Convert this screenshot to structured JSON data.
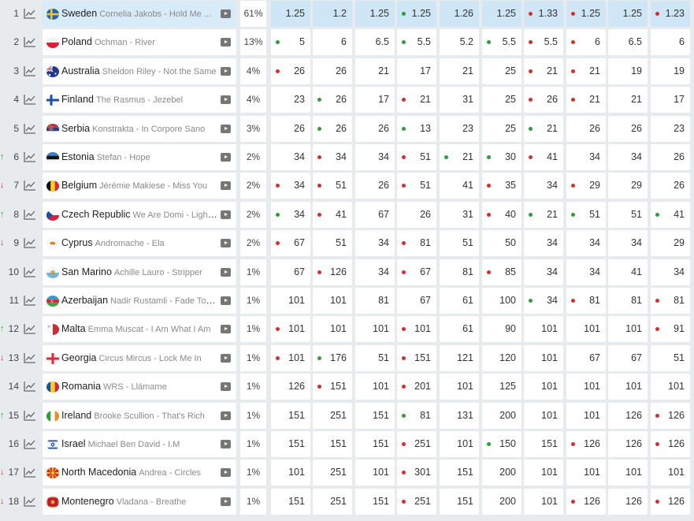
{
  "rows": [
    {
      "rank": "1",
      "trend": "",
      "country": "Sweden",
      "song": "Cornelia Jakobs - Hold Me ...",
      "pct": "61%",
      "flag": "sweden",
      "odds": [
        {
          "v": "1.25",
          "d": ""
        },
        {
          "v": "1.2",
          "d": ""
        },
        {
          "v": "1.25",
          "d": ""
        },
        {
          "v": "1.25",
          "d": "green"
        },
        {
          "v": "1.26",
          "d": ""
        },
        {
          "v": "1.25",
          "d": ""
        },
        {
          "v": "1.33",
          "d": "red"
        },
        {
          "v": "1.25",
          "d": "red"
        },
        {
          "v": "1.25",
          "d": ""
        },
        {
          "v": "1.23",
          "d": "red"
        }
      ]
    },
    {
      "rank": "2",
      "trend": "",
      "country": "Poland",
      "song": "Ochman - River",
      "pct": "13%",
      "flag": "poland",
      "odds": [
        {
          "v": "5",
          "d": "green"
        },
        {
          "v": "6",
          "d": ""
        },
        {
          "v": "6.5",
          "d": ""
        },
        {
          "v": "5.5",
          "d": "green"
        },
        {
          "v": "5.2",
          "d": ""
        },
        {
          "v": "5.5",
          "d": "green"
        },
        {
          "v": "5.5",
          "d": "red"
        },
        {
          "v": "6",
          "d": "red"
        },
        {
          "v": "6.5",
          "d": ""
        },
        {
          "v": "6",
          "d": ""
        }
      ]
    },
    {
      "rank": "3",
      "trend": "",
      "country": "Australia",
      "song": "Sheldon Riley - Not the Same",
      "pct": "4%",
      "flag": "australia",
      "odds": [
        {
          "v": "26",
          "d": "red"
        },
        {
          "v": "26",
          "d": ""
        },
        {
          "v": "21",
          "d": ""
        },
        {
          "v": "17",
          "d": ""
        },
        {
          "v": "21",
          "d": ""
        },
        {
          "v": "25",
          "d": ""
        },
        {
          "v": "21",
          "d": "red"
        },
        {
          "v": "21",
          "d": "red"
        },
        {
          "v": "19",
          "d": ""
        },
        {
          "v": "19",
          "d": ""
        }
      ]
    },
    {
      "rank": "4",
      "trend": "",
      "country": "Finland",
      "song": "The Rasmus - Jezebel",
      "pct": "4%",
      "flag": "finland",
      "odds": [
        {
          "v": "23",
          "d": ""
        },
        {
          "v": "26",
          "d": "green"
        },
        {
          "v": "17",
          "d": ""
        },
        {
          "v": "21",
          "d": "red"
        },
        {
          "v": "31",
          "d": ""
        },
        {
          "v": "25",
          "d": ""
        },
        {
          "v": "26",
          "d": "red"
        },
        {
          "v": "21",
          "d": "red"
        },
        {
          "v": "21",
          "d": ""
        },
        {
          "v": "17",
          "d": ""
        }
      ]
    },
    {
      "rank": "5",
      "trend": "",
      "country": "Serbia",
      "song": "Konstrakta - In Corpore Sano",
      "pct": "3%",
      "flag": "serbia",
      "odds": [
        {
          "v": "26",
          "d": ""
        },
        {
          "v": "26",
          "d": "green"
        },
        {
          "v": "26",
          "d": ""
        },
        {
          "v": "13",
          "d": "green"
        },
        {
          "v": "23",
          "d": ""
        },
        {
          "v": "25",
          "d": ""
        },
        {
          "v": "21",
          "d": "green"
        },
        {
          "v": "26",
          "d": ""
        },
        {
          "v": "26",
          "d": ""
        },
        {
          "v": "23",
          "d": ""
        }
      ]
    },
    {
      "rank": "6",
      "trend": "up",
      "country": "Estonia",
      "song": "Stefan - Hope",
      "pct": "2%",
      "flag": "estonia",
      "odds": [
        {
          "v": "34",
          "d": ""
        },
        {
          "v": "34",
          "d": "red"
        },
        {
          "v": "34",
          "d": ""
        },
        {
          "v": "51",
          "d": "red"
        },
        {
          "v": "21",
          "d": "green"
        },
        {
          "v": "30",
          "d": "green"
        },
        {
          "v": "41",
          "d": "red"
        },
        {
          "v": "34",
          "d": ""
        },
        {
          "v": "34",
          "d": ""
        },
        {
          "v": "26",
          "d": ""
        }
      ]
    },
    {
      "rank": "7",
      "trend": "down",
      "country": "Belgium",
      "song": "Jérémie Makiese - Miss You",
      "pct": "2%",
      "flag": "belgium",
      "odds": [
        {
          "v": "34",
          "d": "red"
        },
        {
          "v": "51",
          "d": "red"
        },
        {
          "v": "26",
          "d": ""
        },
        {
          "v": "51",
          "d": "red"
        },
        {
          "v": "41",
          "d": ""
        },
        {
          "v": "35",
          "d": "red"
        },
        {
          "v": "34",
          "d": ""
        },
        {
          "v": "29",
          "d": "red"
        },
        {
          "v": "29",
          "d": ""
        },
        {
          "v": "26",
          "d": ""
        }
      ]
    },
    {
      "rank": "8",
      "trend": "up",
      "country": "Czech Republic",
      "song": "We Are Domi - Lights Off",
      "pct": "2%",
      "flag": "czech",
      "odds": [
        {
          "v": "34",
          "d": "green"
        },
        {
          "v": "41",
          "d": "red"
        },
        {
          "v": "67",
          "d": ""
        },
        {
          "v": "26",
          "d": ""
        },
        {
          "v": "31",
          "d": ""
        },
        {
          "v": "40",
          "d": "red"
        },
        {
          "v": "21",
          "d": "green"
        },
        {
          "v": "51",
          "d": "green"
        },
        {
          "v": "51",
          "d": ""
        },
        {
          "v": "41",
          "d": "green"
        }
      ]
    },
    {
      "rank": "9",
      "trend": "down",
      "country": "Cyprus",
      "song": "Andromache - Ela",
      "pct": "2%",
      "flag": "cyprus",
      "odds": [
        {
          "v": "67",
          "d": "red"
        },
        {
          "v": "51",
          "d": ""
        },
        {
          "v": "34",
          "d": ""
        },
        {
          "v": "81",
          "d": "red"
        },
        {
          "v": "51",
          "d": ""
        },
        {
          "v": "50",
          "d": ""
        },
        {
          "v": "34",
          "d": ""
        },
        {
          "v": "34",
          "d": ""
        },
        {
          "v": "34",
          "d": ""
        },
        {
          "v": "29",
          "d": ""
        }
      ]
    },
    {
      "rank": "10",
      "trend": "",
      "country": "San Marino",
      "song": "Achille Lauro - Stripper",
      "pct": "1%",
      "flag": "sanmarino",
      "odds": [
        {
          "v": "67",
          "d": ""
        },
        {
          "v": "126",
          "d": "red"
        },
        {
          "v": "34",
          "d": ""
        },
        {
          "v": "67",
          "d": "red"
        },
        {
          "v": "81",
          "d": ""
        },
        {
          "v": "85",
          "d": "red"
        },
        {
          "v": "34",
          "d": ""
        },
        {
          "v": "34",
          "d": ""
        },
        {
          "v": "41",
          "d": ""
        },
        {
          "v": "34",
          "d": ""
        }
      ]
    },
    {
      "rank": "11",
      "trend": "",
      "country": "Azerbaijan",
      "song": "Nadir Rustamli - Fade To Black",
      "pct": "1%",
      "flag": "azerbaijan",
      "odds": [
        {
          "v": "101",
          "d": ""
        },
        {
          "v": "101",
          "d": ""
        },
        {
          "v": "81",
          "d": ""
        },
        {
          "v": "67",
          "d": ""
        },
        {
          "v": "61",
          "d": ""
        },
        {
          "v": "100",
          "d": ""
        },
        {
          "v": "34",
          "d": "green"
        },
        {
          "v": "81",
          "d": "red"
        },
        {
          "v": "81",
          "d": ""
        },
        {
          "v": "81",
          "d": "red"
        }
      ]
    },
    {
      "rank": "12",
      "trend": "up",
      "country": "Malta",
      "song": "Emma Muscat - I Am What I Am",
      "pct": "1%",
      "flag": "malta",
      "odds": [
        {
          "v": "101",
          "d": "red"
        },
        {
          "v": "101",
          "d": ""
        },
        {
          "v": "101",
          "d": ""
        },
        {
          "v": "101",
          "d": "red"
        },
        {
          "v": "61",
          "d": ""
        },
        {
          "v": "90",
          "d": ""
        },
        {
          "v": "101",
          "d": ""
        },
        {
          "v": "101",
          "d": ""
        },
        {
          "v": "101",
          "d": ""
        },
        {
          "v": "91",
          "d": "red"
        }
      ]
    },
    {
      "rank": "13",
      "trend": "down",
      "country": "Georgia",
      "song": "Circus Mircus - Lock Me In",
      "pct": "1%",
      "flag": "georgia",
      "odds": [
        {
          "v": "101",
          "d": "red"
        },
        {
          "v": "176",
          "d": "green"
        },
        {
          "v": "51",
          "d": ""
        },
        {
          "v": "151",
          "d": "red"
        },
        {
          "v": "121",
          "d": ""
        },
        {
          "v": "120",
          "d": ""
        },
        {
          "v": "101",
          "d": ""
        },
        {
          "v": "67",
          "d": ""
        },
        {
          "v": "67",
          "d": ""
        },
        {
          "v": "51",
          "d": ""
        }
      ]
    },
    {
      "rank": "14",
      "trend": "",
      "country": "Romania",
      "song": "WRS - Llámame",
      "pct": "1%",
      "flag": "romania",
      "odds": [
        {
          "v": "126",
          "d": ""
        },
        {
          "v": "151",
          "d": "red"
        },
        {
          "v": "101",
          "d": ""
        },
        {
          "v": "201",
          "d": "red"
        },
        {
          "v": "101",
          "d": ""
        },
        {
          "v": "125",
          "d": ""
        },
        {
          "v": "101",
          "d": ""
        },
        {
          "v": "101",
          "d": ""
        },
        {
          "v": "101",
          "d": ""
        },
        {
          "v": "101",
          "d": ""
        }
      ]
    },
    {
      "rank": "15",
      "trend": "up",
      "country": "Ireland",
      "song": "Brooke Scullion - That's Rich",
      "pct": "1%",
      "flag": "ireland",
      "odds": [
        {
          "v": "151",
          "d": ""
        },
        {
          "v": "251",
          "d": ""
        },
        {
          "v": "151",
          "d": ""
        },
        {
          "v": "81",
          "d": "green"
        },
        {
          "v": "131",
          "d": ""
        },
        {
          "v": "200",
          "d": ""
        },
        {
          "v": "101",
          "d": ""
        },
        {
          "v": "101",
          "d": ""
        },
        {
          "v": "126",
          "d": ""
        },
        {
          "v": "126",
          "d": "red"
        }
      ]
    },
    {
      "rank": "16",
      "trend": "",
      "country": "Israel",
      "song": "Michael Ben David - I.M",
      "pct": "1%",
      "flag": "israel",
      "odds": [
        {
          "v": "151",
          "d": ""
        },
        {
          "v": "151",
          "d": ""
        },
        {
          "v": "151",
          "d": ""
        },
        {
          "v": "251",
          "d": "red"
        },
        {
          "v": "101",
          "d": ""
        },
        {
          "v": "150",
          "d": "green"
        },
        {
          "v": "151",
          "d": ""
        },
        {
          "v": "126",
          "d": "red"
        },
        {
          "v": "126",
          "d": ""
        },
        {
          "v": "126",
          "d": "red"
        }
      ]
    },
    {
      "rank": "17",
      "trend": "down",
      "country": "North Macedonia",
      "song": "Andrea - Circles",
      "pct": "1%",
      "flag": "northmacedonia",
      "odds": [
        {
          "v": "101",
          "d": ""
        },
        {
          "v": "251",
          "d": ""
        },
        {
          "v": "101",
          "d": ""
        },
        {
          "v": "301",
          "d": "red"
        },
        {
          "v": "151",
          "d": ""
        },
        {
          "v": "200",
          "d": ""
        },
        {
          "v": "101",
          "d": ""
        },
        {
          "v": "101",
          "d": ""
        },
        {
          "v": "101",
          "d": ""
        },
        {
          "v": "101",
          "d": ""
        }
      ]
    },
    {
      "rank": "18",
      "trend": "down",
      "country": "Montenegro",
      "song": "Vladana - Breathe",
      "pct": "1%",
      "flag": "montenegro",
      "odds": [
        {
          "v": "151",
          "d": ""
        },
        {
          "v": "251",
          "d": ""
        },
        {
          "v": "151",
          "d": ""
        },
        {
          "v": "251",
          "d": "red"
        },
        {
          "v": "151",
          "d": ""
        },
        {
          "v": "200",
          "d": ""
        },
        {
          "v": "101",
          "d": ""
        },
        {
          "v": "126",
          "d": "red"
        },
        {
          "v": "126",
          "d": ""
        },
        {
          "v": "126",
          "d": "red"
        }
      ]
    }
  ],
  "colors": {
    "dot_red": "#d32f2f",
    "dot_green": "#2e9d3a",
    "highlight": "#d7ebf8"
  }
}
